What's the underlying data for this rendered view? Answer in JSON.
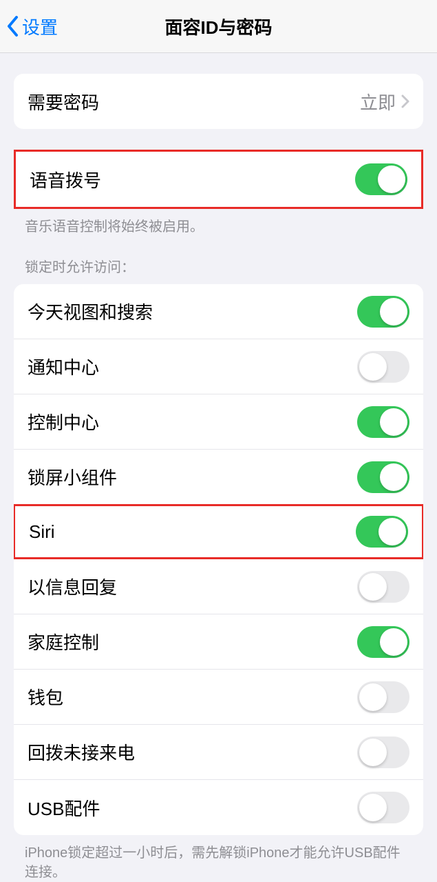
{
  "nav": {
    "back_label": "设置",
    "title": "面容ID与密码"
  },
  "require_passcode": {
    "label": "需要密码",
    "value": "立即"
  },
  "voice_dial": {
    "label": "语音拨号",
    "on": true,
    "footer": "音乐语音控制将始终被启用。"
  },
  "lock_access": {
    "header": "锁定时允许访问：",
    "items": [
      {
        "label": "今天视图和搜索",
        "on": true,
        "highlighted": false
      },
      {
        "label": "通知中心",
        "on": false,
        "highlighted": false
      },
      {
        "label": "控制中心",
        "on": true,
        "highlighted": false
      },
      {
        "label": "锁屏小组件",
        "on": true,
        "highlighted": false
      },
      {
        "label": "Siri",
        "on": true,
        "highlighted": true
      },
      {
        "label": "以信息回复",
        "on": false,
        "highlighted": false
      },
      {
        "label": "家庭控制",
        "on": true,
        "highlighted": false
      },
      {
        "label": "钱包",
        "on": false,
        "highlighted": false
      },
      {
        "label": "回拨未接来电",
        "on": false,
        "highlighted": false
      },
      {
        "label": "USB配件",
        "on": false,
        "highlighted": false
      }
    ],
    "footer": "iPhone锁定超过一小时后，需先解锁iPhone才能允许USB配件连接。"
  }
}
